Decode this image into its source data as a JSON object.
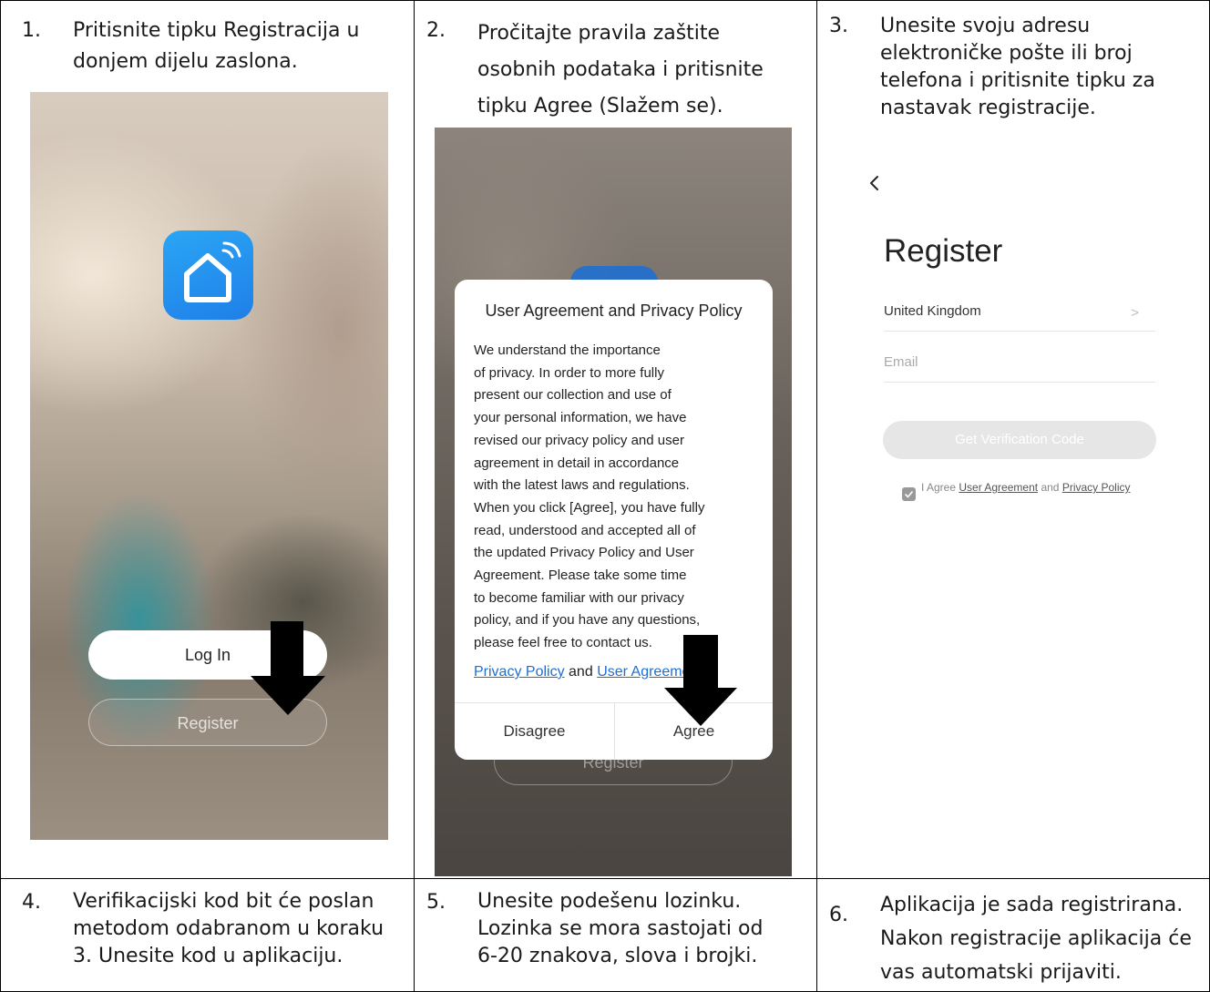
{
  "steps": [
    {
      "num": "1.",
      "text": "Pritisnite tipku Registracija u donjem dijelu zaslona."
    },
    {
      "num": "2.",
      "text": "Pročitajte pravila zaštite osobnih podataka i pritisnite tipku Agree (Slažem se)."
    },
    {
      "num": "3.",
      "text": "Unesite svoju adresu elektroničke pošte ili broj telefona i pritisnite tipku za nastavak registracije."
    },
    {
      "num": "4.",
      "text": "Verifikacijski kod bit će poslan metodom odabranom u koraku 3. Unesite kod u aplikaciju."
    },
    {
      "num": "5.",
      "text": "Unesite podešenu lozinku. Lozinka se mora sastojati od 6-20 znakova, slova i brojki."
    },
    {
      "num": "6.",
      "text": "Aplikacija je sada registrirana. Nakon registracije aplikacija će vas automatski prijaviti."
    }
  ],
  "screen1": {
    "app_icon": "smart-home-icon",
    "login_label": "Log In",
    "register_label": "Register"
  },
  "screen2": {
    "dialog_title": "User Agreement and Privacy Policy",
    "dialog_body": "We understand the importance\nof privacy. In order to more fully\npresent our collection and use of\nyour personal information, we have\nrevised our privacy policy and user\nagreement in detail in accordance\nwith the latest laws and regulations.\nWhen you click [Agree], you have fully\nread, understood and accepted all of\nthe updated Privacy Policy and User\nAgreement. Please take some time\nto become familiar with our privacy\npolicy, and if you have any questions,\nplease feel free to contact us.",
    "link_privacy": "Privacy Policy",
    "link_and": "and",
    "link_user_agreement": "User Agreement",
    "disagree_label": "Disagree",
    "agree_label": "Agree",
    "background_register_label": "Register"
  },
  "screen3": {
    "title": "Register",
    "country": "United Kingdom",
    "email_placeholder": "Email",
    "verify_button": "Get Verification Code",
    "agree_prefix": "I Agree",
    "agree_link1": "User Agreement",
    "agree_and": "and",
    "agree_link2": "Privacy Policy"
  }
}
